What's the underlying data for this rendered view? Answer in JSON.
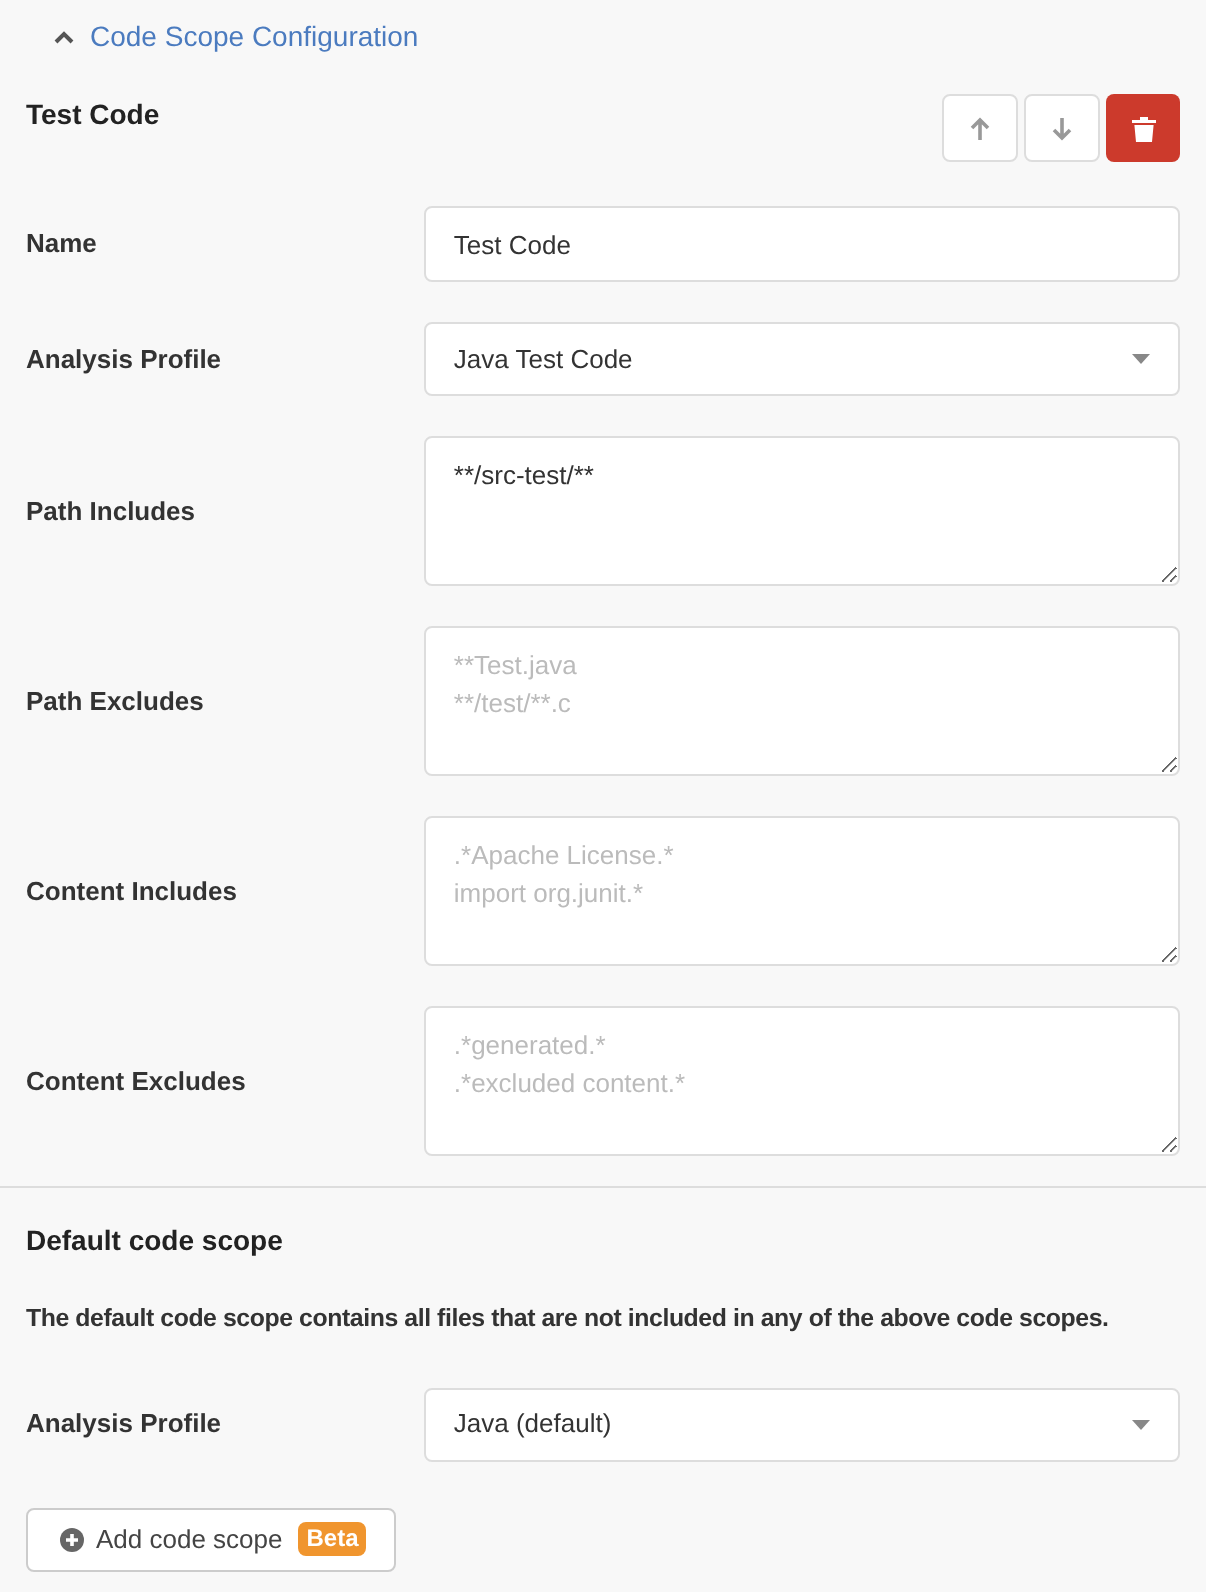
{
  "section_header": {
    "label": "Code Scope Configuration",
    "expanded": true
  },
  "scope": {
    "title": "Test Code",
    "actions": [
      {
        "kind": "up"
      },
      {
        "kind": "down"
      },
      {
        "kind": "delete"
      }
    ],
    "fields": [
      {
        "label": "Name",
        "kind": "text",
        "value": "Test Code"
      },
      {
        "label": "Analysis Profile",
        "kind": "select",
        "value": "Java Test Code"
      },
      {
        "label": "Path Includes",
        "kind": "textarea",
        "value": "**/src-test/**"
      },
      {
        "label": "Path Excludes",
        "kind": "textarea",
        "placeholder": "**Test.java\n**/test/**.c"
      },
      {
        "label": "Content Includes",
        "kind": "textarea",
        "placeholder": ".*Apache License.*\nimport org.junit.*"
      },
      {
        "label": "Content Excludes",
        "kind": "textarea",
        "placeholder": ".*generated.*\n.*excluded content.*"
      }
    ]
  },
  "default_scope": {
    "title": "Default code scope",
    "description": "The default code scope contains all files that are not included in any of the above code scopes.",
    "fields": [
      {
        "label": "Analysis Profile",
        "kind": "select",
        "value": "Java (default)"
      }
    ]
  },
  "add_button": {
    "label": "Add code scope",
    "badge": "Beta"
  }
}
